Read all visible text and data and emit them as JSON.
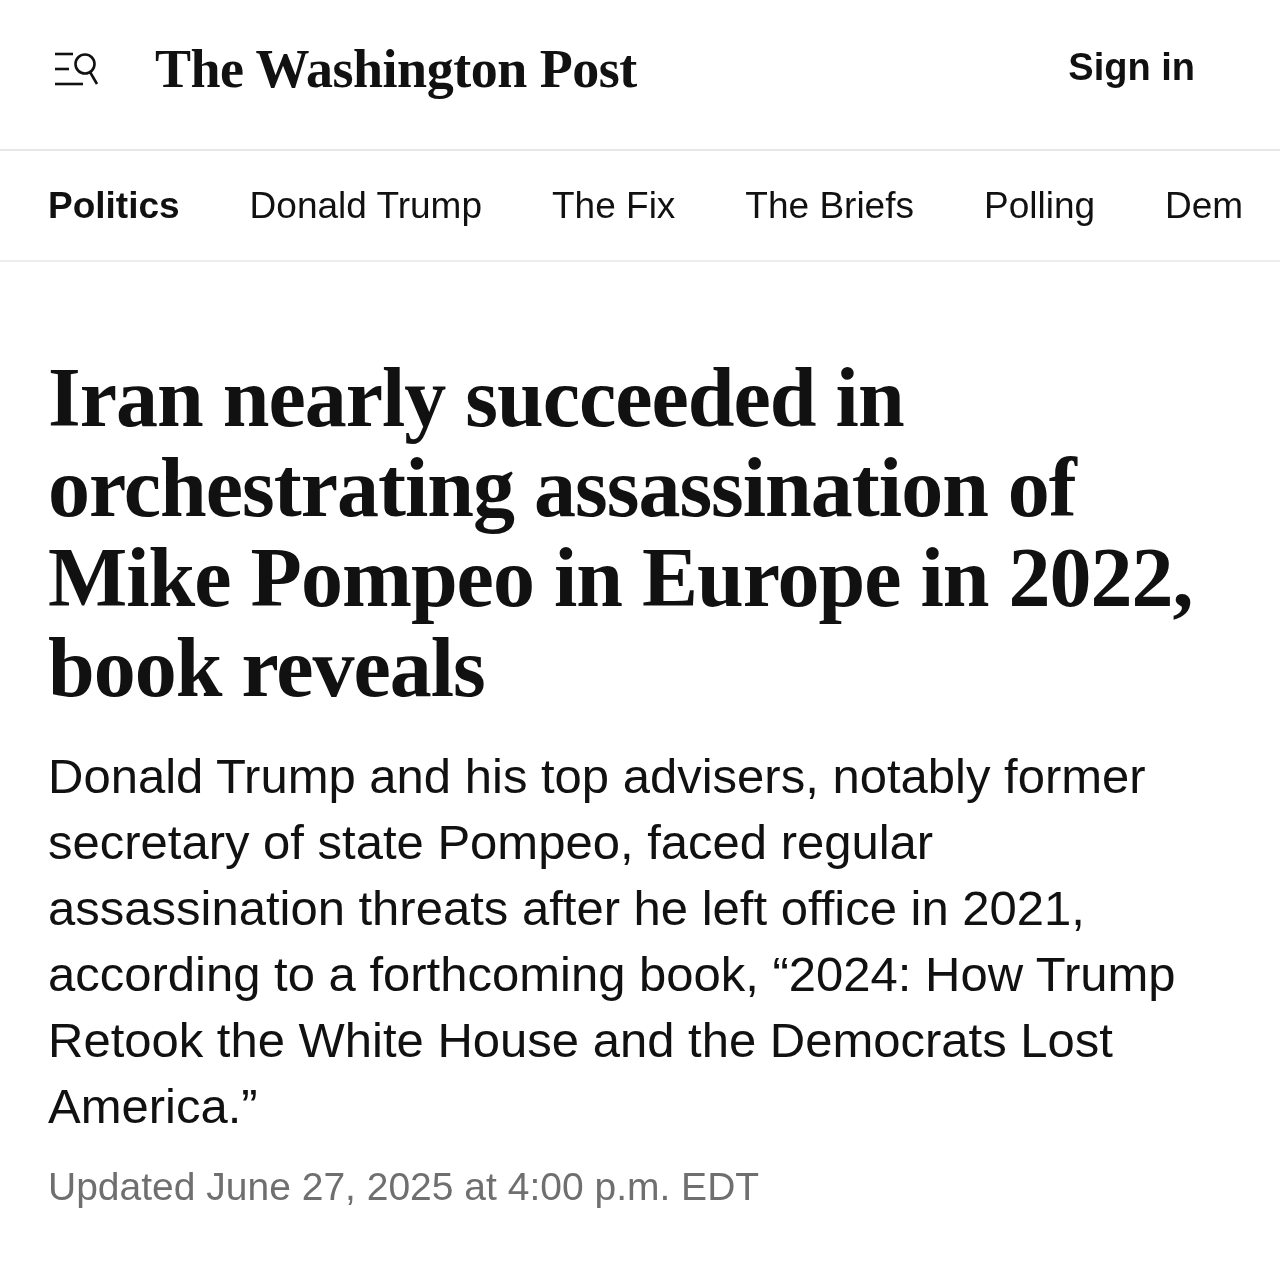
{
  "header": {
    "logo": "The Washington Post",
    "sign_in": "Sign in"
  },
  "nav": {
    "items": [
      {
        "label": "Politics",
        "selected": true
      },
      {
        "label": "Donald Trump",
        "selected": false
      },
      {
        "label": "The Fix",
        "selected": false
      },
      {
        "label": "The Briefs",
        "selected": false
      },
      {
        "label": "Polling",
        "selected": false
      },
      {
        "label": "Dem",
        "selected": false
      }
    ]
  },
  "article": {
    "headline": "Iran nearly succeeded in orchestrating assassination of Mike Pompeo in Europe in 2022, book reveals",
    "dek": "Donald Trump and his top advisers, notably former secretary of state Pompeo, faced regular assassination threats after he left office in 2021, according to a forthcoming book, “2024: How Trump Retook the White House and the Democrats Lost America.”",
    "timestamp": "Updated June 27, 2025 at 4:00 p.m. EDT"
  }
}
